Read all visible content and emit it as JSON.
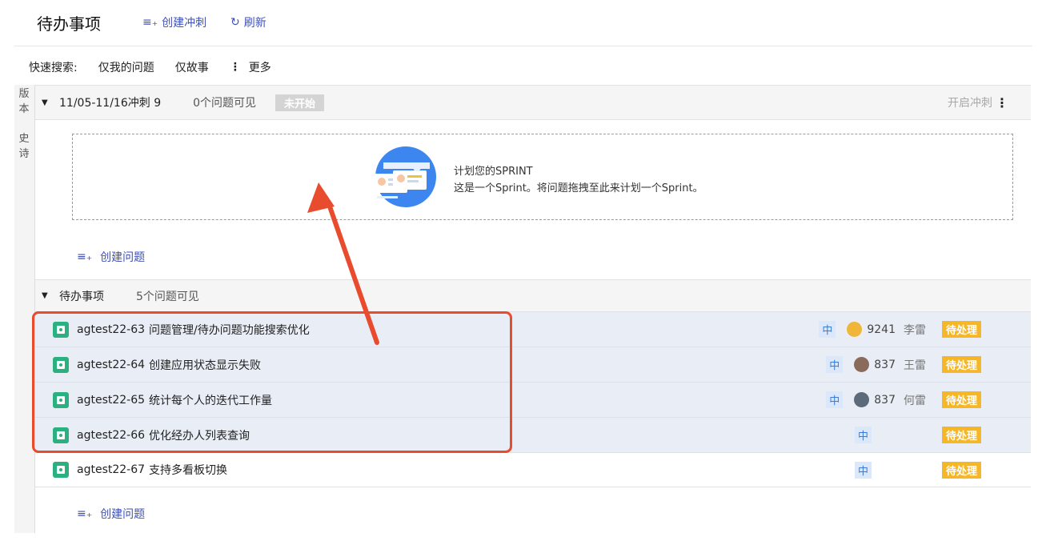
{
  "header": {
    "title": "待办事项",
    "create_sprint_label": "创建冲刺",
    "refresh_label": "刷新"
  },
  "quick_search": {
    "label": "快速搜索:",
    "filters": [
      "仅我的问题",
      "仅故事"
    ],
    "more_label": "更多"
  },
  "side_tabs": [
    "版本",
    "史诗"
  ],
  "sprint": {
    "name": "11/05-11/16冲刺 9",
    "count_text": "0个问题可见",
    "status": "未开始",
    "start_label": "开启冲刺",
    "empty_title": "计划您的SPRINT",
    "empty_desc": "这是一个Sprint。将问题拖拽至此来计划一个Sprint。",
    "create_issue_label": "创建问题"
  },
  "backlog": {
    "title": "待办事项",
    "count_text": "5个问题可见",
    "create_issue_label": "创建问题",
    "issues": [
      {
        "key": "agtest22-63",
        "summary": "问题管理/待办问题功能搜索优化",
        "priority": "中",
        "points": "9241",
        "assignee": "李雷",
        "status": "待处理",
        "selected": true,
        "avatar_color": "#f0b63a"
      },
      {
        "key": "agtest22-64",
        "summary": "创建应用状态显示失败",
        "priority": "中",
        "points": "837",
        "assignee": "王雷",
        "status": "待处理",
        "selected": true,
        "avatar_color": "#8a6a5a"
      },
      {
        "key": "agtest22-65",
        "summary": "统计每个人的迭代工作量",
        "priority": "中",
        "points": "837",
        "assignee": "何雷",
        "status": "待处理",
        "selected": true,
        "avatar_color": "#5c6a7a"
      },
      {
        "key": "agtest22-66",
        "summary": "优化经办人列表查询",
        "priority": "中",
        "points": "",
        "assignee": "",
        "status": "待处理",
        "selected": true,
        "avatar_color": ""
      },
      {
        "key": "agtest22-67",
        "summary": "支持多看板切换",
        "priority": "中",
        "points": "",
        "assignee": "",
        "status": "待处理",
        "selected": false,
        "avatar_color": ""
      }
    ]
  },
  "colors": {
    "accent": "#3f51b5",
    "story_icon": "#2bb07f",
    "status_todo": "#f6b726",
    "highlight": "#e94b2e"
  }
}
